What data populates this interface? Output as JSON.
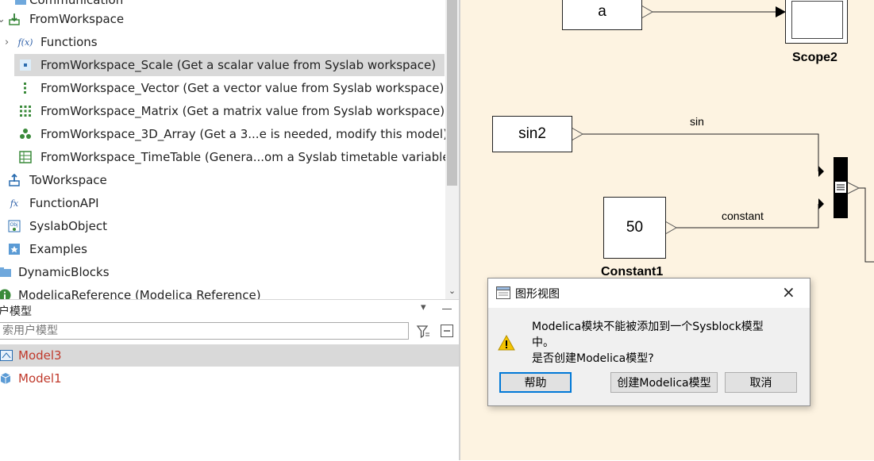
{
  "tree": {
    "items": [
      {
        "label": "Communication",
        "icon": "folder-icon"
      },
      {
        "label": "FromWorkspace",
        "icon": "from-workspace-icon"
      },
      {
        "label": "Functions",
        "icon": "function-icon"
      },
      {
        "label": "FromWorkspace_Scale (Get a scalar value from Syslab workspace)",
        "icon": "scalar-icon"
      },
      {
        "label": "FromWorkspace_Vector (Get a vector value from Syslab workspace)",
        "icon": "vector-icon"
      },
      {
        "label": "FromWorkspace_Matrix (Get a matrix value from Syslab workspace)",
        "icon": "matrix-icon"
      },
      {
        "label": "FromWorkspace_3D_Array (Get a 3...e is needed, modify this model)",
        "icon": "array3d-icon"
      },
      {
        "label": "FromWorkspace_TimeTable (Genera...om a Syslab timetable variable)",
        "icon": "timetable-icon"
      },
      {
        "label": "ToWorkspace",
        "icon": "to-workspace-icon"
      },
      {
        "label": "FunctionAPI",
        "icon": "function-api-icon"
      },
      {
        "label": "SyslabObject",
        "icon": "syslab-object-icon"
      },
      {
        "label": "Examples",
        "icon": "examples-icon"
      },
      {
        "label": "DynamicBlocks",
        "icon": "folder-icon"
      },
      {
        "label": "ModelicaReference (Modelica Reference)",
        "icon": "info-icon"
      }
    ]
  },
  "models": {
    "title": "户模型",
    "search_placeholder": "索用户模型",
    "items": [
      {
        "label": "Model3",
        "icon": "model-diagram-icon"
      },
      {
        "label": "Model1",
        "icon": "model-cube-icon"
      }
    ]
  },
  "canvas": {
    "blocks": {
      "a": "a",
      "sin2": "sin2",
      "constant_value": "50",
      "constant_name": "Constant1",
      "scope_name": "Scope2"
    },
    "signals": {
      "sin": "sin",
      "constant": "constant"
    }
  },
  "dialog": {
    "title": "图形视图",
    "message_line1": "Modelica模块不能被添加到一个Sysblock模型",
    "message_line2": "中。",
    "message_line3": "是否创建Modelica模型?",
    "buttons": {
      "help": "帮助",
      "create": "创建Modelica模型",
      "cancel": "取消"
    }
  },
  "colors": {
    "canvas_bg": "#fdf3e1",
    "selection": "#d9d9d9",
    "model_text": "#c0392b",
    "accent": "#0078d7",
    "warning": "#f5c400"
  }
}
